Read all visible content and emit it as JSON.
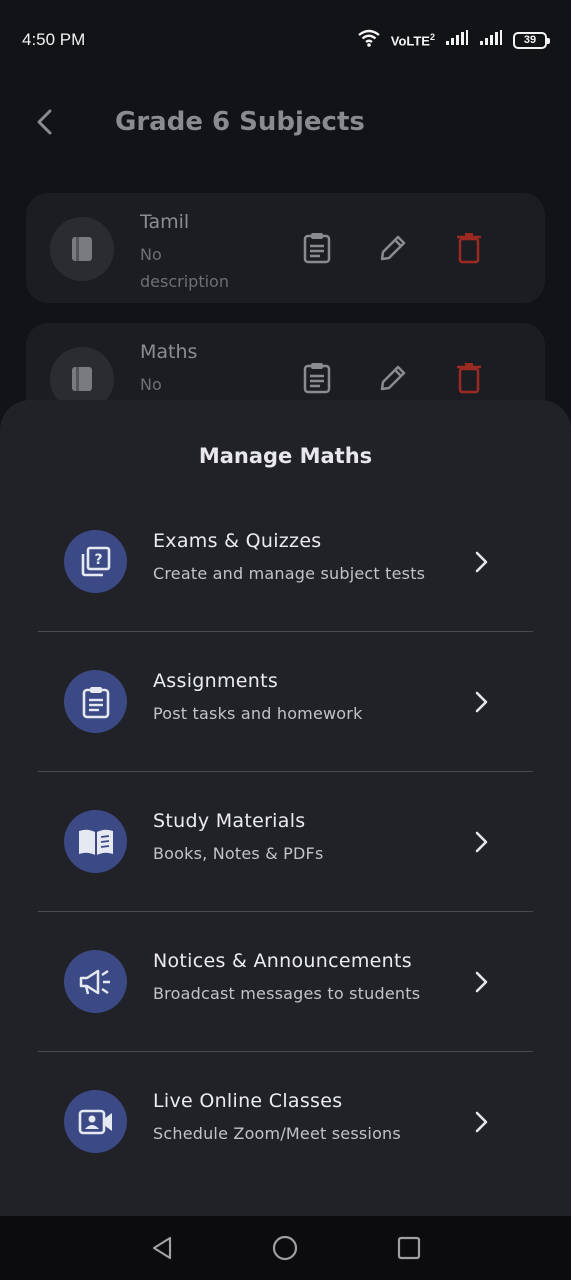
{
  "status_bar": {
    "time": "4:50 PM",
    "network": "VoLTE",
    "sim": "2",
    "battery": "39"
  },
  "header": {
    "title": "Grade 6 Subjects",
    "back_icon": "back-chevron-icon"
  },
  "subjects": [
    {
      "name": "Tamil",
      "description": "No description"
    },
    {
      "name": "Maths",
      "description": "No"
    }
  ],
  "sheet": {
    "title": "Manage Maths",
    "options": [
      {
        "title": "Exams & Quizzes",
        "subtitle": "Create and manage subject tests",
        "icon": "quiz-icon"
      },
      {
        "title": "Assignments",
        "subtitle": "Post tasks and homework",
        "icon": "assignment-icon"
      },
      {
        "title": "Study Materials",
        "subtitle": "Books, Notes & PDFs",
        "icon": "book-icon"
      },
      {
        "title": "Notices & Announcements",
        "subtitle": "Broadcast messages to students",
        "icon": "megaphone-icon"
      },
      {
        "title": "Live Online Classes",
        "subtitle": "Schedule Zoom/Meet sessions",
        "icon": "video-icon"
      }
    ]
  },
  "colors": {
    "accent": "#3b4a85",
    "delete": "#9b2a22",
    "sheet_bg": "#212227",
    "page_bg": "#121317"
  }
}
